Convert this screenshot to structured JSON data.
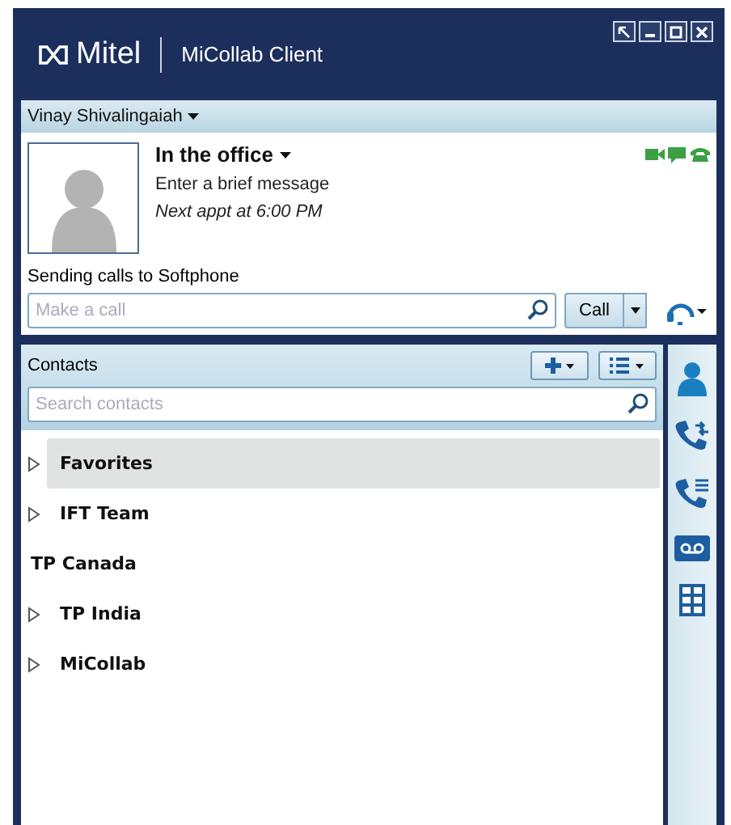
{
  "window": {
    "logo": "Mitel",
    "title": "MiCollab Client"
  },
  "user": {
    "name": "Vinay Shivalingaiah",
    "status": "In the office",
    "message": "Enter a brief message",
    "next_appt": "Next appt at 6:00 PM",
    "routing": "Sending calls to Softphone"
  },
  "call": {
    "placeholder": "Make a call",
    "button": "Call"
  },
  "contacts": {
    "title": "Contacts",
    "search_placeholder": "Search contacts",
    "items": [
      {
        "label": "Favorites",
        "expandable": true,
        "selected": true
      },
      {
        "label": "IFT Team",
        "expandable": true,
        "selected": false
      },
      {
        "label": "TP Canada",
        "expandable": false,
        "selected": false
      },
      {
        "label": "TP India",
        "expandable": true,
        "selected": false
      },
      {
        "label": "MiCollab",
        "expandable": true,
        "selected": false
      }
    ]
  }
}
